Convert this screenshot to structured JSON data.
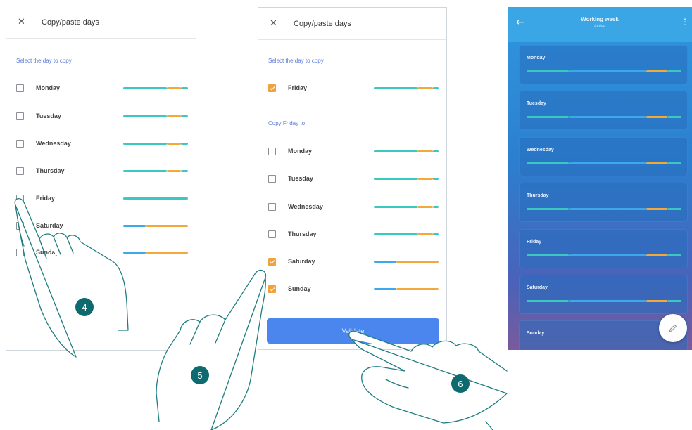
{
  "panel1": {
    "title": "Copy/paste days",
    "close_icon": "close-icon",
    "section_label": "Select the day to copy",
    "days": [
      {
        "label": "Monday",
        "checked": false
      },
      {
        "label": "Tuesday",
        "checked": false
      },
      {
        "label": "Wednesday",
        "checked": false
      },
      {
        "label": "Thursday",
        "checked": false
      },
      {
        "label": "Friday",
        "checked": false
      },
      {
        "label": "Saturday",
        "checked": false
      },
      {
        "label": "Sunday",
        "checked": false
      }
    ]
  },
  "panel2": {
    "title": "Copy/paste days",
    "close_icon": "close-icon",
    "section_label_select": "Select the day to copy",
    "selected_day": {
      "label": "Friday",
      "checked": true
    },
    "section_label_copy": "Copy Friday to",
    "targets": [
      {
        "label": "Monday",
        "checked": false
      },
      {
        "label": "Tuesday",
        "checked": false
      },
      {
        "label": "Wednesday",
        "checked": false
      },
      {
        "label": "Thursday",
        "checked": false
      },
      {
        "label": "Saturday",
        "checked": true
      },
      {
        "label": "Sunday",
        "checked": true
      }
    ],
    "validate_label": "Validate"
  },
  "panel3": {
    "title": "Working week",
    "subtitle": "Active",
    "back_icon": "back-arrow-icon",
    "menu_icon": "kebab-menu-icon",
    "edit_icon": "pencil-icon",
    "days": [
      "Monday",
      "Tuesday",
      "Wednesday",
      "Thursday",
      "Friday",
      "Saturday",
      "Sunday"
    ]
  },
  "steps": [
    "4",
    "5",
    "6"
  ],
  "colors": {
    "teal_segment": "#3cc8c0",
    "orange_segment": "#f2a93b",
    "blue_segment": "#3da8ea",
    "checkbox_checked": "#f0a23b",
    "validate_button": "#4a86ee",
    "step_badge": "#0f6a6f",
    "app_header": "#3aa6e6"
  }
}
